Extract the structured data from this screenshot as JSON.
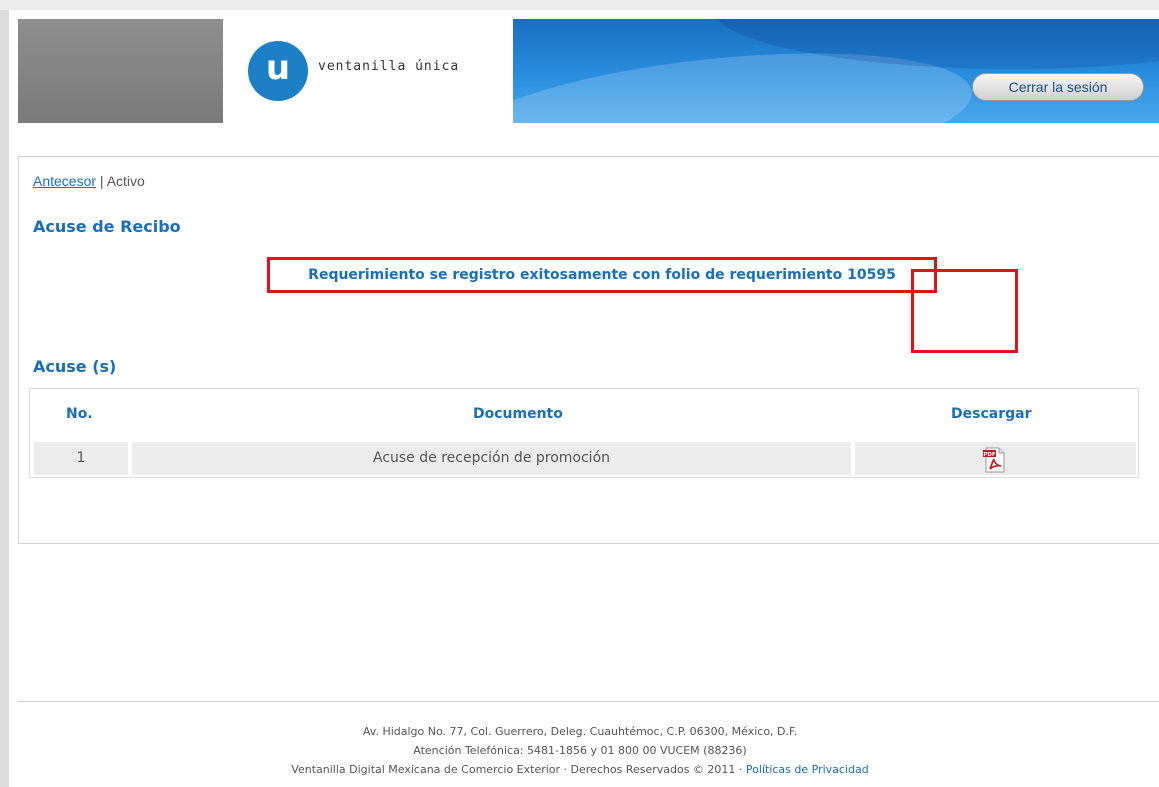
{
  "header": {
    "logo_letter": "u",
    "logo_text": "ventanilla única",
    "logout_label": "Cerrar la sesión"
  },
  "breadcrumb": {
    "previous": "Antecesor",
    "separator": " | ",
    "current": "Activo"
  },
  "acuse_recibo": {
    "title": "Acuse de Recibo",
    "message": "Requerimiento se registro exitosamente con folio de requerimiento 10595"
  },
  "acuses": {
    "title": "Acuse (s)",
    "columns": [
      "No.",
      "Documento",
      "Descargar"
    ],
    "rows": [
      {
        "no": "1",
        "documento": "Acuse de recepción de promoción",
        "icon": "pdf-icon"
      }
    ]
  },
  "footer": {
    "address": "Av. Hidalgo No. 77, Col. Guerrero, Deleg. Cuauhtémoc, C.P. 06300, México, D.F.",
    "phone": "Atención Telefónica: 5481-1856 y 01 800 00 VUCEM (88236)",
    "rights": "Ventanilla Digital Mexicana de Comercio Exterior · Derechos Reservados © 2011 · ",
    "privacy_link": "Políticas de Privacidad"
  },
  "colors": {
    "brand_blue": "#1a6fb8",
    "highlight_red": "#e2121a"
  }
}
